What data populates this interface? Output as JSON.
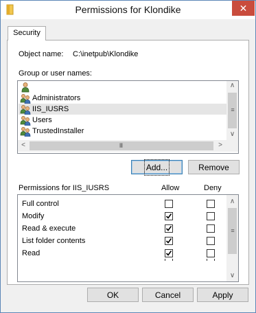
{
  "window": {
    "title": "Permissions for Klondike",
    "close_glyph": "✕",
    "icon": "folder-icon"
  },
  "tabs": [
    {
      "label": "Security"
    }
  ],
  "object": {
    "label": "Object name:",
    "value": "C:\\inetpub\\Klondike"
  },
  "group_list": {
    "label": "Group or user names:",
    "items": [
      {
        "label": "",
        "icon": "single-user-icon"
      },
      {
        "label": "Administrators",
        "icon": "group-icon"
      },
      {
        "label": "IIS_IUSRS",
        "icon": "group-icon",
        "selected": true
      },
      {
        "label": "Users",
        "icon": "group-icon"
      },
      {
        "label": "TrustedInstaller",
        "icon": "group-icon"
      }
    ]
  },
  "group_buttons": {
    "add": "Add...",
    "remove": "Remove"
  },
  "permissions": {
    "title": "Permissions for IIS_IUSRS",
    "allow_header": "Allow",
    "deny_header": "Deny",
    "rows": [
      {
        "name": "Full control",
        "allow": false,
        "deny": false
      },
      {
        "name": "Modify",
        "allow": true,
        "deny": false
      },
      {
        "name": "Read & execute",
        "allow": true,
        "deny": false
      },
      {
        "name": "List folder contents",
        "allow": true,
        "deny": false
      },
      {
        "name": "Read",
        "allow": true,
        "deny": false
      }
    ]
  },
  "dialog_buttons": {
    "ok": "OK",
    "cancel": "Cancel",
    "apply": "Apply"
  },
  "scroll_glyphs": {
    "up": "∧",
    "down": "∨",
    "left": "<",
    "right": ">",
    "grip_v": "≡",
    "grip_h": "III"
  },
  "colors": {
    "selection": "#e5e5e5",
    "focus_border": "#3c7fb1",
    "close_button": "#c94c3d"
  }
}
